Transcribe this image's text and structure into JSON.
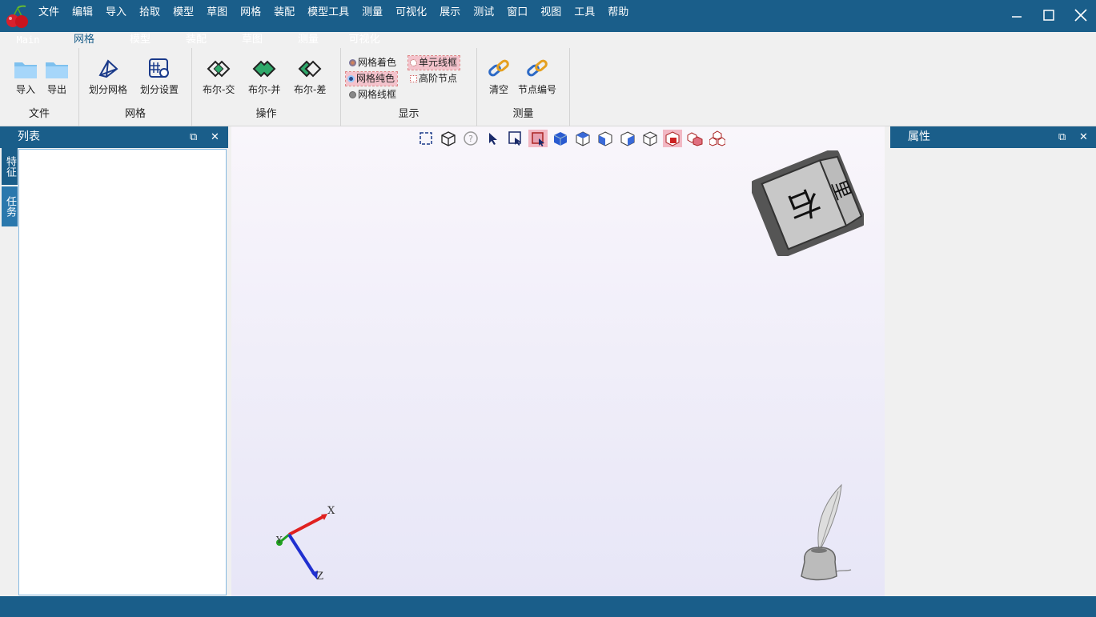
{
  "menu": {
    "items": [
      "文件",
      "编辑",
      "导入",
      "拾取",
      "模型",
      "草图",
      "网格",
      "装配",
      "模型工具",
      "测量",
      "可视化",
      "展示",
      "测试",
      "窗口",
      "视图",
      "工具",
      "帮助"
    ]
  },
  "tabs": [
    {
      "label": "Main",
      "active": false
    },
    {
      "label": "网格",
      "active": true
    },
    {
      "label": "模型",
      "active": false
    },
    {
      "label": "装配",
      "active": false
    },
    {
      "label": "草图",
      "active": false
    },
    {
      "label": "测量",
      "active": false
    },
    {
      "label": "可视化",
      "active": false
    }
  ],
  "ribbon": {
    "file_group": {
      "label": "文件",
      "import": "导入",
      "export": "导出"
    },
    "mesh_group": {
      "label": "网格",
      "divide": "划分网格",
      "settings": "划分设置"
    },
    "ops_group": {
      "label": "操作",
      "intersect": "布尔-交",
      "union": "布尔-并",
      "diff": "布尔-差"
    },
    "display_group": {
      "label": "显示",
      "mesh_colored": "网格着色",
      "mesh_solid": "网格纯色",
      "mesh_wireframe": "网格线框",
      "element_wireframe": "单元线框",
      "high_order_nodes": "高阶节点"
    },
    "measure_group": {
      "label": "测量",
      "clear": "清空",
      "node_number": "节点编号"
    }
  },
  "left_panel": {
    "title": "列表",
    "side_tabs": [
      "特征",
      "任务"
    ]
  },
  "right_panel": {
    "title": "属性"
  },
  "viewport": {
    "cube_front": "右",
    "cube_side": "里",
    "axis_x": "X",
    "axis_y": "Y",
    "axis_z": "Z"
  },
  "colors": {
    "chrome_blue": "#1a5e8a",
    "highlight_pink": "#f4c3cc",
    "axis_x": "#e02020",
    "axis_y": "#20a020",
    "axis_z": "#2030d0"
  }
}
